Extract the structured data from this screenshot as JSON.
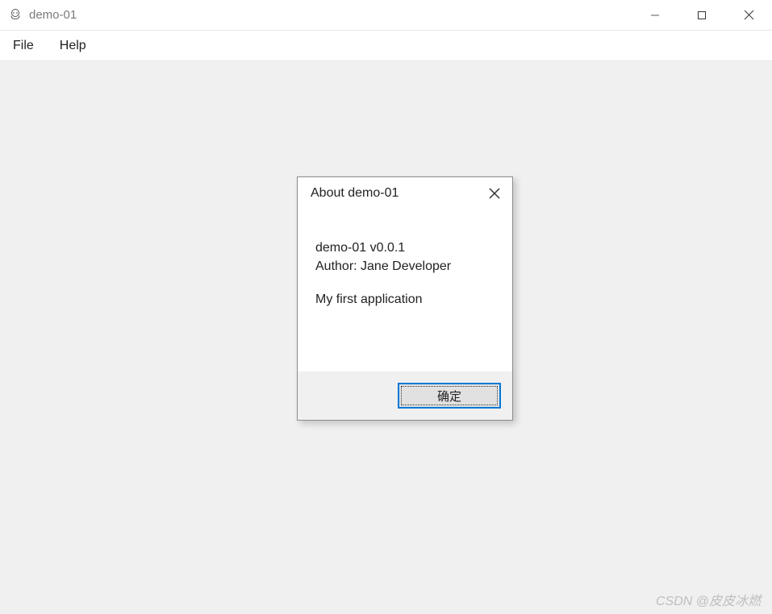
{
  "window": {
    "title": "demo-01"
  },
  "menu": {
    "items": [
      {
        "label": "File"
      },
      {
        "label": "Help"
      }
    ]
  },
  "dialog": {
    "title": "About demo-01",
    "line_version": "demo-01 v0.0.1",
    "line_author": "Author: Jane Developer",
    "line_desc": "My first application",
    "ok_label": "确定"
  },
  "watermark": "CSDN @皮皮冰燃"
}
